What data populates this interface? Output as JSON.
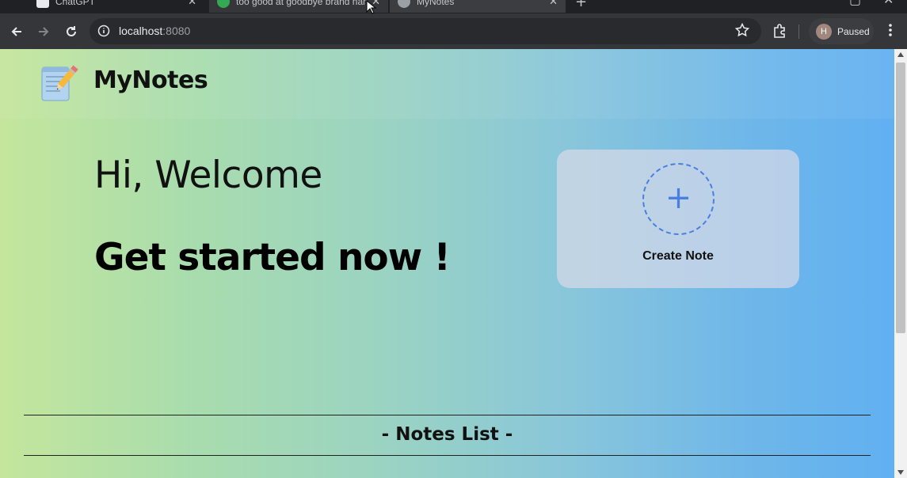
{
  "browser": {
    "tabs": [
      {
        "title": "ChatGPT",
        "icon": "chatgpt-icon"
      },
      {
        "title": "too good at goodbye brand name",
        "icon": "google-icon"
      },
      {
        "title": "MyNotes",
        "icon": "globe-icon"
      }
    ],
    "url": {
      "host": "localhost",
      "port": ":8080"
    },
    "profile": {
      "initial": "H",
      "status": "Paused"
    }
  },
  "page": {
    "brand": "MyNotes",
    "greeting": "Hi, Welcome",
    "cta_heading": "Get started now !",
    "create_card": {
      "label": "Create Note",
      "icon": "plus-icon"
    },
    "notes_section_title": "- Notes List -"
  },
  "colors": {
    "gradient_start": "#c4e69c",
    "gradient_end": "#61b0f2",
    "accent": "#4a7fe0",
    "card_bg": "#d7dae8"
  }
}
